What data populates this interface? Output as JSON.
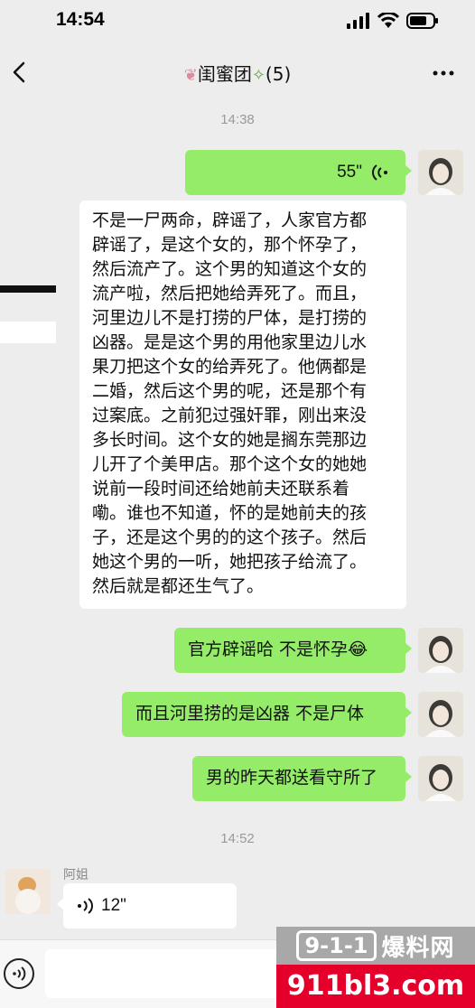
{
  "status": {
    "time": "14:54"
  },
  "header": {
    "title": "闺蜜团",
    "count": "(5)"
  },
  "timestamps": [
    "14:38",
    "14:52"
  ],
  "messages": {
    "voice_out": {
      "duration": "55\""
    },
    "long_text": "不是一尸两命，辟谣了，人家官方都\n辟谣了，是这个女的，那个怀孕了，\n然后流产了。这个男的知道这个女的\n流产啦，然后把她给弄死了。而且，\n河里边儿不是打捞的尸体，是打捞的\n凶器。是是这个男的用他家里边儿水\n果刀把这个女的给弄死了。他俩都是\n二婚，然后这个男的呢，还是那个有\n过案底。之前犯过强奸罪，刚出来没\n多长时间。这个女的她是搁东莞那边\n儿开了个美甲店。那个这个女的她她\n说前一段时间还给她前夫还联系着\n嘞。谁也不知道，怀的是她前夫的孩\n子，还是这个男的的这个孩子。然后\n她这个男的一听，她把孩子给流了。\n然后就是都还生气了。",
    "reply1": "官方辟谣哈  不是怀孕😂",
    "reply2": "而且河里捞的是凶器  不是尸体",
    "reply3": "男的昨天都送看守所了",
    "sender_name": "阿姐",
    "voice_in": {
      "duration": "12\""
    }
  },
  "watermark": {
    "logo": "9-1-1",
    "name": "爆料网",
    "url": "911bl3.com"
  },
  "colors": {
    "bubble_green": "#95ec69",
    "background": "#ededed",
    "watermark_red": "#e4002b"
  }
}
